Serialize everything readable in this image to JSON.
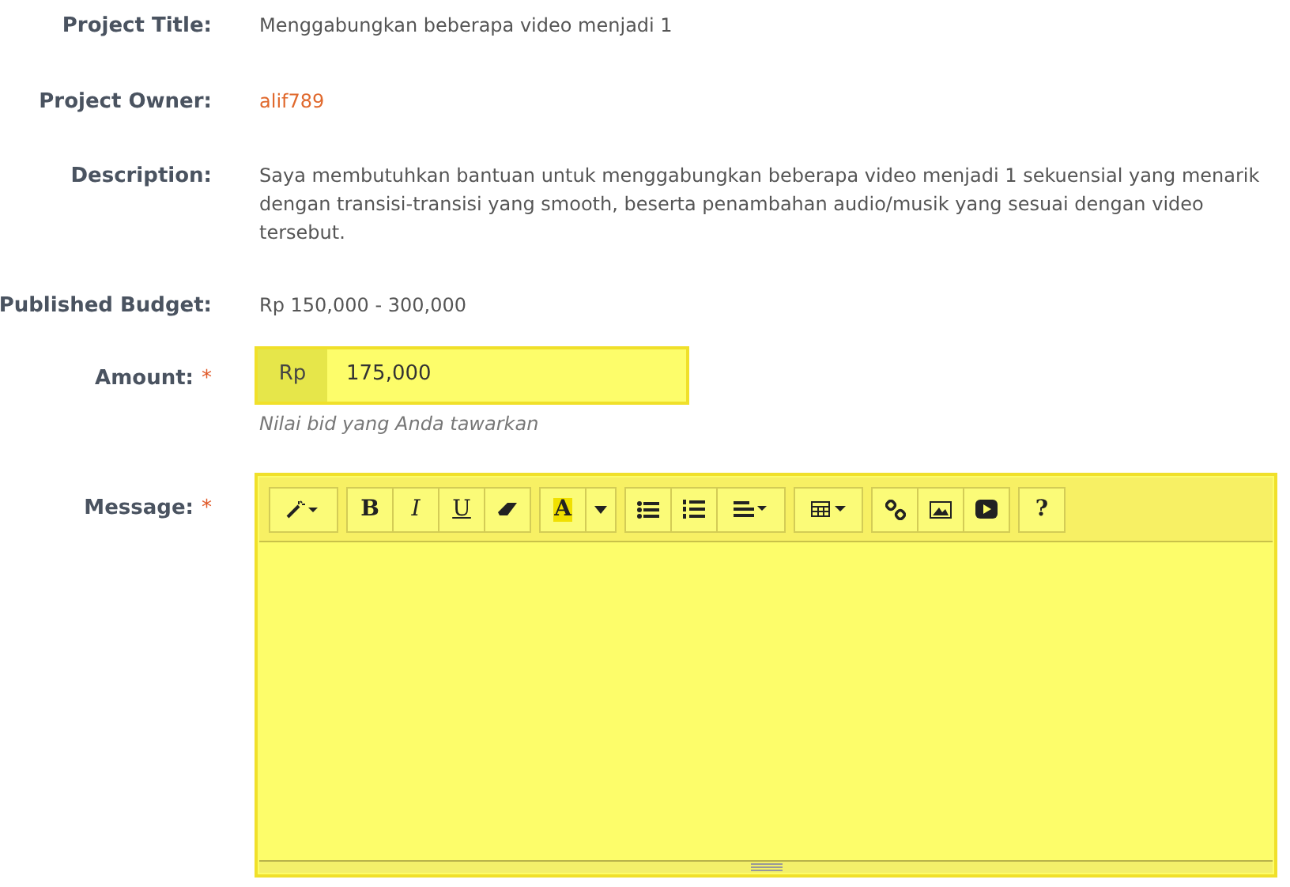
{
  "fields": [
    {
      "label": "Project Title:",
      "value": "Menggabungkan beberapa video menjadi 1",
      "kind": "text"
    },
    {
      "label": "Project Owner:",
      "value": "alif789",
      "kind": "link"
    },
    {
      "label": "Description:",
      "value": "Saya membutuhkan bantuan untuk menggabungkan beberapa video menjadi 1 sekuensial yang menarik dengan transisi-transisi yang smooth, beserta penambahan audio/musik yang sesuai dengan video tersebut.",
      "kind": "text"
    },
    {
      "label": "Published Budget:",
      "value": "Rp 150,000 - 300,000",
      "kind": "text"
    }
  ],
  "amount": {
    "label": "Amount:",
    "required": "*",
    "prefix": "Rp",
    "value": "175,000",
    "hint": "Nilai bid yang Anda tawarkan"
  },
  "message": {
    "label": "Message:",
    "required": "*",
    "toolbar": [
      [
        {
          "kind": "magic"
        }
      ],
      [
        {
          "kind": "bold",
          "label": "B"
        },
        {
          "kind": "italic",
          "label": "I"
        },
        {
          "kind": "underline",
          "label": "U"
        },
        {
          "kind": "eraser"
        }
      ],
      [
        {
          "kind": "highlight",
          "label": "A"
        },
        {
          "kind": "caret"
        }
      ],
      [
        {
          "kind": "bullets"
        },
        {
          "kind": "numbers"
        },
        {
          "kind": "align"
        }
      ],
      [
        {
          "kind": "table"
        }
      ],
      [
        {
          "kind": "link"
        },
        {
          "kind": "image"
        },
        {
          "kind": "video"
        }
      ],
      [
        {
          "kind": "help",
          "label": "?"
        }
      ]
    ]
  }
}
